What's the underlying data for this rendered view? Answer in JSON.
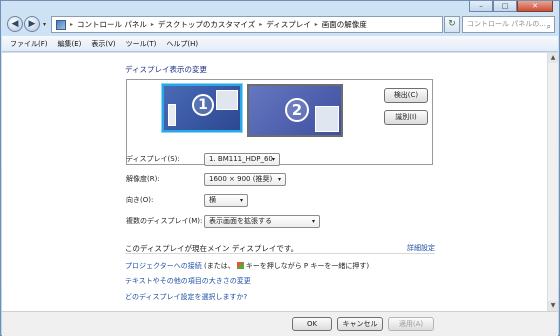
{
  "title_bar": {
    "minimize": "–",
    "maximize": "□",
    "close": "✕"
  },
  "nav": {
    "back_glyph": "◀",
    "forward_glyph": "▶",
    "dropdown_glyph": "▾",
    "breadcrumbs": [
      "コントロール パネル",
      "デスクトップのカスタマイズ",
      "ディスプレイ",
      "画面の解像度"
    ],
    "separator": "▸",
    "refresh_glyph": "↻",
    "search_placeholder": "コントロール パネルの...",
    "search_glyph": "⌕"
  },
  "menu": [
    "ファイル(F)",
    "編集(E)",
    "表示(V)",
    "ツール(T)",
    "ヘルプ(H)"
  ],
  "main": {
    "heading": "ディスプレイ表示の変更",
    "monitor1_number": "1",
    "monitor2_number": "2",
    "detect_button": "検出(C)",
    "identify_button": "識別(I)",
    "display_label": "ディスプレイ(S):",
    "display_value": "1. BM111_HDP_60",
    "resolution_label": "解像度(R):",
    "resolution_value": "1600 × 900 (推奨)",
    "orientation_label": "向き(O):",
    "orientation_value": "横",
    "multi_label": "複数のディスプレイ(M):",
    "multi_value": "表示画面を拡張する",
    "main_display_text": "このディスプレイが現在メイン ディスプレイです。",
    "advanced_link": "詳細設定",
    "projector_link": "プロジェクターへの接続",
    "projector_hint_pre": "(または、",
    "projector_hint_post": "キーを押しながら P キーを一緒に押す)",
    "text_size_link": "テキストやその他の項目の大きさの変更",
    "which_settings_link": "どのディスプレイ設定を選択しますか?"
  },
  "buttons": {
    "ok": "OK",
    "cancel": "キャンセル",
    "apply": "適用(A)"
  },
  "scrollbar": {
    "up": "▲",
    "down": "▼"
  },
  "select_arrow": "▾"
}
